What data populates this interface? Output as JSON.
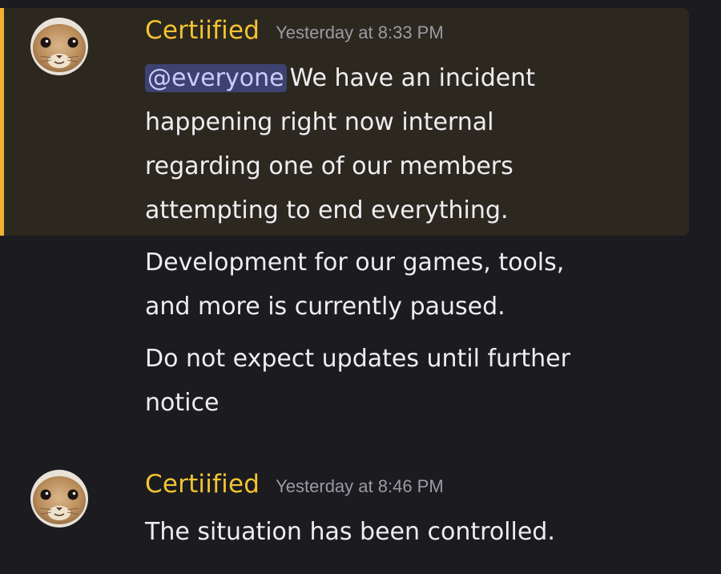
{
  "messages": [
    {
      "username": "Certiified",
      "timestamp": "Yesterday at 8:33 PM",
      "mention": "@everyone",
      "highlighted": true,
      "lines": [
        "We have an incident",
        "happening right now internal",
        "regarding one of our members",
        "attempting to end everything.",
        "Development for our games, tools,",
        "and more is currently paused.",
        "Do not expect updates until further",
        "notice"
      ]
    },
    {
      "username": "Certiified",
      "timestamp": "Yesterday at 8:46 PM",
      "lines": [
        "The situation has been controlled."
      ]
    }
  ],
  "colors": {
    "background": "#1b1b20",
    "highlight_background": "#2c2820",
    "highlight_bar": "#f0b232",
    "username": "#f3c431",
    "mention_background": "#3d4270",
    "mention_text": "#c9cdfb"
  },
  "avatar_icon": "cat-face-avatar-icon"
}
